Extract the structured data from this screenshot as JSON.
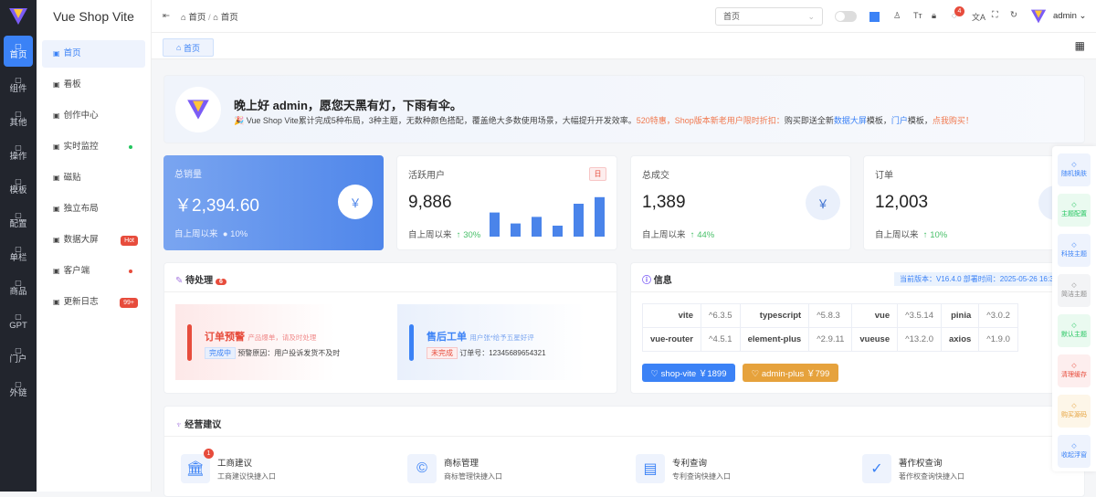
{
  "app": {
    "title": "Vue Shop Vite"
  },
  "rail": [
    {
      "label": "首页",
      "icon": "home-icon",
      "active": true
    },
    {
      "label": "组件",
      "icon": "grid-icon"
    },
    {
      "label": "其他",
      "icon": "grid-icon"
    },
    {
      "label": "操作",
      "icon": "user-icon"
    },
    {
      "label": "模板",
      "icon": "calendar-icon"
    },
    {
      "label": "配置",
      "icon": "user-icon"
    },
    {
      "label": "单栏",
      "icon": "file-icon"
    },
    {
      "label": "商品",
      "icon": "shop-icon"
    },
    {
      "label": "GPT",
      "icon": "chat-icon"
    },
    {
      "label": "门户",
      "icon": "portal-icon"
    },
    {
      "label": "外链",
      "icon": "external-link-icon"
    }
  ],
  "sidebar": {
    "items": [
      {
        "label": "首页",
        "active": true
      },
      {
        "label": "看板"
      },
      {
        "label": "创作中心"
      },
      {
        "label": "实时监控",
        "dot": "#22c55e"
      },
      {
        "label": "磁贴"
      },
      {
        "label": "独立布局"
      },
      {
        "label": "数据大屏",
        "badge": "Hot"
      },
      {
        "label": "客户端",
        "dot": "#e74c3c"
      },
      {
        "label": "更新日志",
        "badge": "99+"
      }
    ]
  },
  "header": {
    "breadcrumb": [
      "首页",
      "首页"
    ],
    "search_value": "首页",
    "notification_count": "4",
    "user": "admin"
  },
  "tabs": [
    {
      "label": "首页"
    }
  ],
  "welcome": {
    "greeting": "晚上好 admin，愿您天黑有灯，下雨有伞。",
    "desc": "🎉 Vue Shop Vite累计完成5种布局，3种主题，无数种颜色搭配，覆盖绝大多数使用场景，大幅提升开发效率。",
    "promo": "520特惠，Shop版本新老用户限时折扣：",
    "desc2": "购买即送全新",
    "link1": "数据大屏",
    "desc3": "模板，",
    "link2": "门户",
    "desc4": "模板，",
    "cta": "点我购买！"
  },
  "stats": [
    {
      "title": "总销量",
      "value": "￥2,394.60",
      "since": "自上周以来",
      "change": "10%"
    },
    {
      "title": "活跃用户",
      "value": "9,886",
      "since": "自上周以来",
      "change": "30%",
      "tag": "日",
      "bars": [
        55,
        30,
        45,
        25,
        75,
        90
      ]
    },
    {
      "title": "总成交",
      "value": "1,389",
      "since": "自上周以来",
      "change": "44%"
    },
    {
      "title": "订单",
      "value": "12,003",
      "since": "自上周以来",
      "change": "10%"
    }
  ],
  "todo": {
    "title": "待处理",
    "count": "6",
    "items": [
      {
        "title": "订单预警",
        "desc": "产品爆单，请及时处理",
        "tag": "完成中",
        "text": "预警原因：用户投诉发货不及时",
        "color": "#e74c3c"
      },
      {
        "title": "售后工单",
        "desc": "用户张*给予五星好评",
        "tag": "未完成",
        "text": "订单号：12345689654321",
        "color": "#3b82f6"
      }
    ]
  },
  "info": {
    "title": "信息",
    "version": "当前版本：V16.4.0 部署时间：2025-05-26 16:3",
    "deps": [
      [
        "vite",
        "^6.3.5",
        "typescript",
        "^5.8.3",
        "vue",
        "^3.5.14",
        "pinia",
        "^3.0.2"
      ],
      [
        "vue-router",
        "^4.5.1",
        "element-plus",
        "^2.9.11",
        "vueuse",
        "^13.2.0",
        "axios",
        "^1.9.0"
      ]
    ],
    "buttons": [
      {
        "label": "♡ shop-vite ￥1899",
        "color": "#3b82f6"
      },
      {
        "label": "♡ admin-plus ￥799",
        "color": "#e6a23c"
      }
    ]
  },
  "suggest": {
    "title": "经营建议",
    "items": [
      {
        "title": "工商建议",
        "desc": "工商建议快捷入口",
        "badge": "1",
        "icon": "bank-icon",
        "glyph": "🏛"
      },
      {
        "title": "商标管理",
        "desc": "商标管理快捷入口",
        "icon": "copyright-icon",
        "glyph": "©"
      },
      {
        "title": "专利查询",
        "desc": "专利查询快捷入口",
        "icon": "document-icon",
        "glyph": "▤"
      },
      {
        "title": "著作权查询",
        "desc": "著作权查询快捷入口",
        "icon": "check-icon",
        "glyph": "✓"
      }
    ]
  },
  "float": [
    {
      "label": "随机换肤",
      "color": "#eef3fd",
      "fg": "#3b82f6"
    },
    {
      "label": "主题配置",
      "color": "#eafaf0",
      "fg": "#22c55e"
    },
    {
      "label": "科技主题",
      "color": "#eef3fd",
      "fg": "#3b82f6"
    },
    {
      "label": "简洁主题",
      "color": "#f3f4f6",
      "fg": "#888"
    },
    {
      "label": "默认主题",
      "color": "#eafaf0",
      "fg": "#22c55e"
    },
    {
      "label": "清理缓存",
      "color": "#fdeeee",
      "fg": "#e74c3c"
    },
    {
      "label": "购买源码",
      "color": "#fdf6e8",
      "fg": "#e6a23c"
    },
    {
      "label": "收起浮窗",
      "color": "#eef3fd",
      "fg": "#3b82f6"
    }
  ]
}
